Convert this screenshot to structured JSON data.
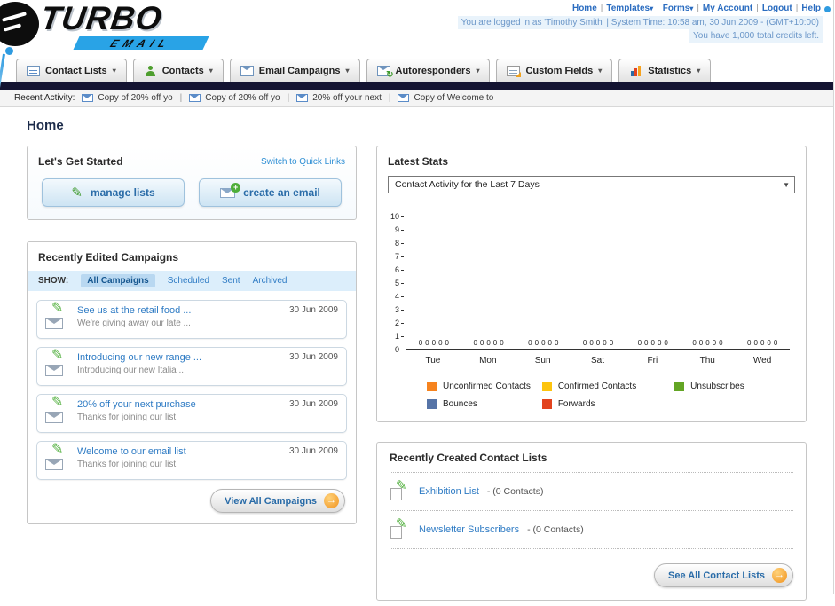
{
  "icons": {
    "pipe": "|",
    "dropdown": "▾",
    "select_arrow": "▼",
    "arrow": "→",
    "pencil": "✎"
  },
  "header": {
    "logo": {
      "main": "TURBO",
      "sub": "EMAIL"
    },
    "nav_links": [
      {
        "label": "Home",
        "dropdown": false
      },
      {
        "label": "Templates",
        "dropdown": true
      },
      {
        "label": "Forms",
        "dropdown": true
      },
      {
        "label": "My Account",
        "dropdown": false
      },
      {
        "label": "Logout",
        "dropdown": false
      },
      {
        "label": "Help",
        "dropdown": false
      }
    ],
    "login_info": "You are logged in as 'Timothy Smith' | System Time: 10:58 am, 30 Jun 2009 - (GMT+10:00)",
    "credits": "You have 1,000 total credits left."
  },
  "nav": {
    "tabs": [
      {
        "label": "Contact Lists",
        "icon": "contact-lists-icon"
      },
      {
        "label": "Contacts",
        "icon": "contacts-icon"
      },
      {
        "label": "Email Campaigns",
        "icon": "email-campaigns-icon"
      },
      {
        "label": "Autoresponders",
        "icon": "autoresponders-icon"
      },
      {
        "label": "Custom Fields",
        "icon": "custom-fields-icon"
      },
      {
        "label": "Statistics",
        "icon": "statistics-icon"
      }
    ]
  },
  "recent_activity": {
    "label": "Recent Activity:",
    "items": [
      "Copy of 20% off yo",
      "Copy of 20% off yo",
      "20% off your next",
      "Copy of Welcome to"
    ]
  },
  "page_title": "Home",
  "get_started": {
    "title": "Let's Get Started",
    "switch_link": "Switch to Quick Links",
    "buttons": [
      {
        "label": "manage lists",
        "icon": "pencil-icon"
      },
      {
        "label": "create an email",
        "icon": "envelope-plus-icon"
      }
    ]
  },
  "campaigns": {
    "title": "Recently Edited Campaigns",
    "show_label": "SHOW:",
    "tabs": [
      {
        "label": "All Campaigns",
        "active": true
      },
      {
        "label": "Scheduled",
        "active": false
      },
      {
        "label": "Sent",
        "active": false
      },
      {
        "label": "Archived",
        "active": false
      }
    ],
    "items": [
      {
        "title": "See us at the retail food ...",
        "subtitle": "We're giving away our late ...",
        "date": "30 Jun 2009"
      },
      {
        "title": "Introducing our new range ...",
        "subtitle": "Introducing our new Italia ...",
        "date": "30 Jun 2009"
      },
      {
        "title": "20% off your next purchase",
        "subtitle": "Thanks for joining our list!",
        "date": "30 Jun 2009"
      },
      {
        "title": "Welcome to our email list",
        "subtitle": "Thanks for joining our list!",
        "date": "30 Jun 2009"
      }
    ],
    "view_all_label": "View All Campaigns"
  },
  "stats": {
    "title": "Latest Stats",
    "filter_value": "Contact Activity for the Last 7 Days",
    "chart_data": {
      "type": "bar",
      "title": "Contact Activity for the Last 7 Days",
      "categories": [
        "Tue",
        "Mon",
        "Sun",
        "Sat",
        "Fri",
        "Thu",
        "Wed"
      ],
      "series": [
        {
          "name": "Unconfirmed Contacts",
          "color": "#f6831e",
          "values": [
            0,
            0,
            0,
            0,
            0,
            0,
            0
          ]
        },
        {
          "name": "Confirmed Contacts",
          "color": "#fdc40e",
          "values": [
            0,
            0,
            0,
            0,
            0,
            0,
            0
          ]
        },
        {
          "name": "Unsubscribes",
          "color": "#63a524",
          "values": [
            0,
            0,
            0,
            0,
            0,
            0,
            0
          ]
        },
        {
          "name": "Bounces",
          "color": "#5674a7",
          "values": [
            0,
            0,
            0,
            0,
            0,
            0,
            0
          ]
        },
        {
          "name": "Forwards",
          "color": "#e2431e",
          "values": [
            0,
            0,
            0,
            0,
            0,
            0,
            0
          ]
        }
      ],
      "xlabel": "",
      "ylabel": "",
      "ylim": [
        0,
        10
      ],
      "yticks": [
        0,
        1,
        2,
        3,
        4,
        5,
        6,
        7,
        8,
        9,
        10
      ],
      "grid": false,
      "legend_position": "bottom"
    }
  },
  "contact_lists": {
    "title": "Recently Created Contact Lists",
    "items": [
      {
        "name": "Exhibition List",
        "detail": "- (0 Contacts)"
      },
      {
        "name": "Newsletter Subscribers",
        "detail": "- (0 Contacts)"
      }
    ],
    "see_all_label": "See All Contact Lists"
  }
}
